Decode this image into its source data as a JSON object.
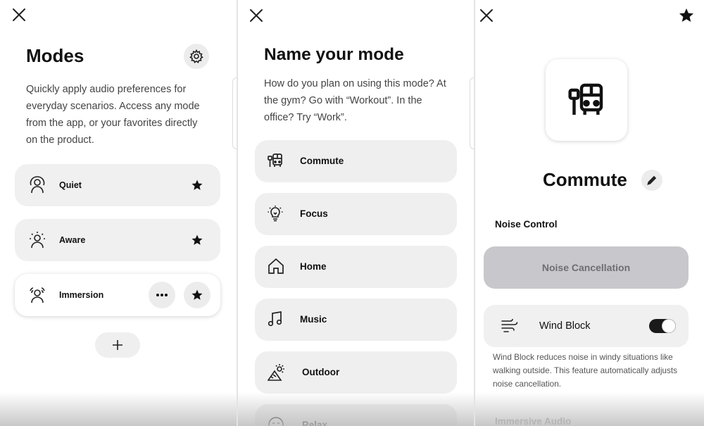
{
  "modes_screen": {
    "title": "Modes",
    "description": "Quickly apply audio preferences for everyday scenarios. Access any mode from the app, or your favorites directly on the product.",
    "modes": [
      {
        "label": "Quiet",
        "icon": "quiet-mode-icon",
        "favorite": true
      },
      {
        "label": "Aware",
        "icon": "aware-mode-icon",
        "favorite": true
      },
      {
        "label": "Immersion",
        "icon": "immersion-mode-icon",
        "favorite": true
      }
    ]
  },
  "name_screen": {
    "title": "Name your mode",
    "description": "How do you plan on using this mode? At the gym? Go with “Workout”. In the office? Try “Work”.",
    "options": [
      {
        "label": "Commute",
        "icon": "bus-icon"
      },
      {
        "label": "Focus",
        "icon": "lightbulb-icon"
      },
      {
        "label": "Home",
        "icon": "home-icon"
      },
      {
        "label": "Music",
        "icon": "music-note-icon"
      },
      {
        "label": "Outdoor",
        "icon": "mountain-sun-icon"
      },
      {
        "label": "Relax",
        "icon": "face-icon"
      }
    ]
  },
  "commute_screen": {
    "mode_name": "Commute",
    "noise_control_label": "Noise Control",
    "noise_cancellation_label": "Noise Cancellation",
    "wind_block_label": "Wind Block",
    "wind_block_on": true,
    "wind_block_help": "Wind Block reduces noise in windy situations like walking outside. This feature automatically adjusts noise cancellation.",
    "immersive_audio_label": "Immersive Audio"
  },
  "colors": {
    "card": "#f0f0f0",
    "selected_button": "#c8c8cc",
    "accent": "#111111"
  }
}
